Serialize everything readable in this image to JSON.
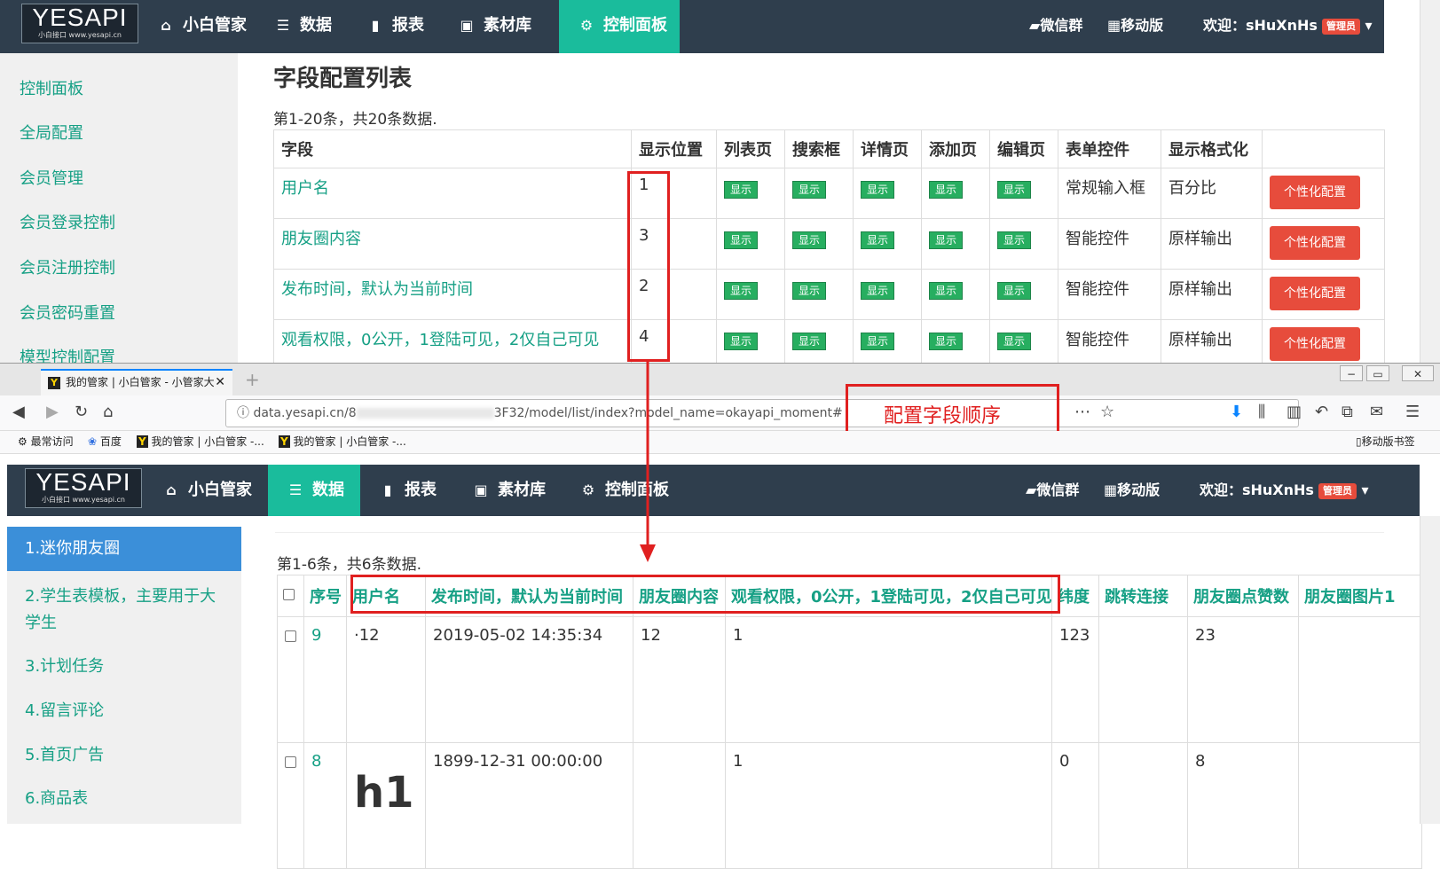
{
  "top": {
    "logo": {
      "text": "YESAPI",
      "sub": "小白接口  www.yesapi.cn"
    },
    "nav": [
      {
        "icon": "home-icon",
        "label": "小白管家"
      },
      {
        "icon": "list-icon",
        "label": "数据"
      },
      {
        "icon": "bar-chart-icon",
        "label": "报表"
      },
      {
        "icon": "image-icon",
        "label": "素材库"
      },
      {
        "icon": "gear-icon",
        "label": "控制面板"
      }
    ],
    "wechat": "微信群",
    "mobile": "移动版",
    "welcome": "欢迎：sHuXnHs",
    "badge": "管理员",
    "sidebar": [
      "控制面板",
      "全局配置",
      "会员管理",
      "会员登录控制",
      "会员注册控制",
      "会员密码重置",
      "模型控制配置"
    ],
    "page_title": "字段配置列表",
    "count": "第1-20条，共20条数据.",
    "table": {
      "headers": [
        "字段",
        "显示位置",
        "列表页",
        "搜索框",
        "详情页",
        "添加页",
        "编辑页",
        "表单控件",
        "显示格式化",
        ""
      ],
      "show_label": "显示",
      "config_label": "个性化配置",
      "rows": [
        {
          "field": "用户名",
          "pos": "1",
          "control": "常规输入框",
          "format": "百分比"
        },
        {
          "field": "朋友圈内容",
          "pos": "3",
          "control": "智能控件",
          "format": "原样输出"
        },
        {
          "field": "发布时间，默认为当前时间",
          "pos": "2",
          "control": "智能控件",
          "format": "原样输出"
        },
        {
          "field": "观看权限，0公开，1登陆可见，2仅自己可见",
          "pos": "4",
          "control": "智能控件",
          "format": "原样输出"
        }
      ]
    }
  },
  "browser": {
    "tab_title": "我的管家 | 小白管家 - 小管家大",
    "url_start": "data.yesapi.cn/8",
    "url_end": "3F32/model/list/index?model_name=okayapi_moment#",
    "annotation": "配置字段顺序",
    "bookmarks": [
      "最常访问",
      "百度",
      "我的管家 | 小白管家 -...",
      "我的管家 | 小白管家 -..."
    ],
    "mobile_bookmarks": "移动版书签"
  },
  "bottom": {
    "sidebar": [
      "1.迷你朋友圈",
      "2.学生表模板，主要用于大学生",
      "3.计划任务",
      "4.留言评论",
      "5.首页广告",
      "6.商品表"
    ],
    "count": "第1-6条，共6条数据.",
    "table": {
      "headers": [
        "序号",
        "用户名",
        "发布时间，默认为当前时间",
        "朋友圈内容",
        "观看权限，0公开，1登陆可见，2仅自己可见",
        "纬度",
        "跳转连接",
        "朋友圈点赞数",
        "朋友圈图片1"
      ],
      "rows": [
        {
          "id": "9",
          "user": "·12",
          "time": "2019-05-02 14:35:34",
          "content": "12",
          "perm": "1",
          "lat": "123",
          "link": "",
          "likes": "23",
          "img": ""
        },
        {
          "id": "8",
          "user": "h1",
          "time": "1899-12-31 00:00:00",
          "content": "",
          "perm": "1",
          "lat": "0",
          "link": "",
          "likes": "8",
          "img": ""
        }
      ]
    }
  }
}
